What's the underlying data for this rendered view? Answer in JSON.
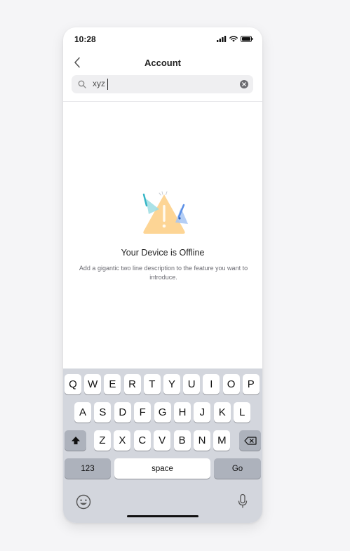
{
  "status_bar": {
    "time": "10:28"
  },
  "nav": {
    "title": "Account"
  },
  "search": {
    "query": "xyz"
  },
  "empty_state": {
    "title": "Your Device is Offline",
    "description": "Add a gigantic two line description to the feature you want to introduce."
  },
  "keyboard": {
    "row1": [
      "Q",
      "W",
      "E",
      "R",
      "T",
      "Y",
      "U",
      "I",
      "O",
      "P"
    ],
    "row2": [
      "A",
      "S",
      "D",
      "F",
      "G",
      "H",
      "J",
      "K",
      "L"
    ],
    "row3": [
      "Z",
      "X",
      "C",
      "V",
      "B",
      "N",
      "M"
    ],
    "numbers_label": "123",
    "space_label": "space",
    "go_label": "Go"
  },
  "colors": {
    "warning_triangle": "#fdd595",
    "pennant_teal": "#36b6c6",
    "pennant_blue": "#5b8fe6",
    "keyboard_bg": "#d3d6dd"
  }
}
